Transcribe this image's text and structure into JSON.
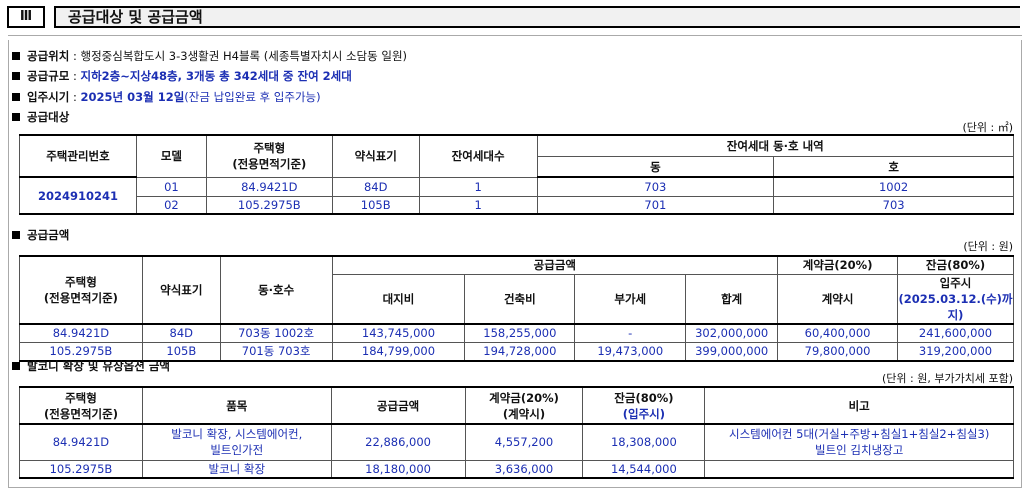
{
  "section": {
    "number": "Ⅲ",
    "title": "공급대상 및 공급금액"
  },
  "info": {
    "location_label": "공급위치",
    "location_value": "행정중심복합도시 3-3생활권 H4블록 (세종특별자치시 소담동 일원)",
    "scale_label": "공급규모",
    "scale_value": "지하2층~지상48층, 3개동 총 342세대 중 잔여 2세대",
    "movein_label": "입주시기",
    "movein_value": "2025년 03월 12일",
    "movein_note": "(잔금 납입완료 후 입주가능)",
    "target_label": "공급대상"
  },
  "table1": {
    "unit": "(단위 : ㎡)",
    "headers": {
      "mgmt_no": "주택관리번호",
      "model": "모델",
      "type": "주택형",
      "type_sub": "(전용면적기준)",
      "abbr": "약식표기",
      "remaining": "잔여세대수",
      "detail": "잔여세대 동·호 내역",
      "dong": "동",
      "ho": "호"
    },
    "mgmt_no": "2024910241",
    "rows": [
      {
        "model": "01",
        "type": "84.9421D",
        "abbr": "84D",
        "remaining": "1",
        "dong": "703",
        "ho": "1002"
      },
      {
        "model": "02",
        "type": "105.2975B",
        "abbr": "105B",
        "remaining": "1",
        "dong": "701",
        "ho": "703"
      }
    ]
  },
  "table2": {
    "section_label": "공급금액",
    "unit": "(단위 : 원)",
    "headers": {
      "type": "주택형",
      "type_sub": "(전용면적기준)",
      "abbr": "약식표기",
      "unitno": "동·호수",
      "supply": "공급금액",
      "land": "대지비",
      "building": "건축비",
      "vat": "부가세",
      "total": "합계",
      "deposit": "계약금(20%)",
      "deposit_when": "계약시",
      "balance": "잔금(80%)",
      "balance_when": "입주시",
      "balance_date": "(2025.03.12.(수)까지)"
    },
    "rows": [
      {
        "type": "84.9421D",
        "abbr": "84D",
        "unitno": "703동 1002호",
        "land": "143,745,000",
        "building": "158,255,000",
        "vat": "-",
        "total": "302,000,000",
        "deposit": "60,400,000",
        "balance": "241,600,000"
      },
      {
        "type": "105.2975B",
        "abbr": "105B",
        "unitno": "701동 703호",
        "land": "184,799,000",
        "building": "194,728,000",
        "vat": "19,473,000",
        "total": "399,000,000",
        "deposit": "79,800,000",
        "balance": "319,200,000"
      }
    ]
  },
  "table3": {
    "section_label": "발코니 확장 및 유상옵션 금액",
    "unit": "(단위 : 원, 부가가치세 포함)",
    "headers": {
      "type": "주택형",
      "type_sub": "(전용면적기준)",
      "item": "품목",
      "supply": "공급금액",
      "deposit": "계약금(20%)",
      "deposit_when": "(계약시)",
      "balance": "잔금(80%)",
      "balance_when": "(입주시)",
      "note": "비고"
    },
    "rows": [
      {
        "type": "84.9421D",
        "item1": "발코니 확장, 시스템에어컨,",
        "item2": "빌트인가전",
        "supply": "22,886,000",
        "deposit": "4,557,200",
        "balance": "18,308,000",
        "note1": "시스템에어컨 5대(거실+주방+침실1+침실2+침실3)",
        "note2": "빌트인 김치냉장고"
      },
      {
        "type": "105.2975B",
        "item1": "발코니 확장",
        "item2": "",
        "supply": "18,180,000",
        "deposit": "3,636,000",
        "balance": "14,544,000",
        "note1": "",
        "note2": ""
      }
    ]
  }
}
